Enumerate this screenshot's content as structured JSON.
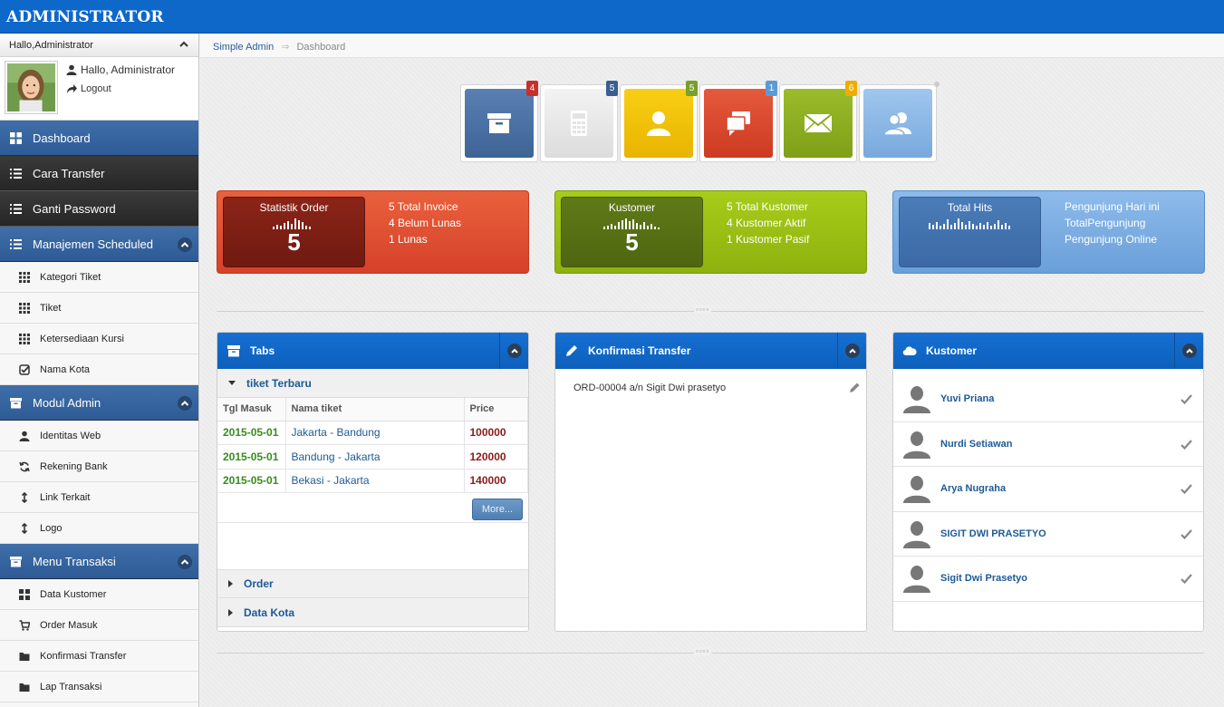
{
  "header": {
    "brand": "ADMINISTRATOR"
  },
  "sidebar": {
    "greeting_header": "Hallo,Administrator",
    "user_name": "Hallo, Administrator",
    "logout_label": "Logout",
    "items": {
      "dashboard": "Dashboard",
      "cara_transfer": "Cara Transfer",
      "ganti_password": "Ganti Password",
      "manajemen_scheduled": "Manajemen Scheduled",
      "kategori_tiket": "Kategori Tiket",
      "tiket": "Tiket",
      "ketersediaan_kursi": "Ketersediaan Kursi",
      "nama_kota": "Nama Kota",
      "modul_admin": "Modul Admin",
      "identitas_web": "Identitas Web",
      "rekening_bank": "Rekening Bank",
      "link_terkait": "Link Terkait",
      "logo": "Logo",
      "menu_transaksi": "Menu Transaksi",
      "data_kustomer": "Data Kustomer",
      "order_masuk": "Order Masuk",
      "konfirmasi_transfer": "Konfirmasi Transfer",
      "lap_transaksi": "Lap Transaksi"
    }
  },
  "breadcrumb": {
    "root": "Simple Admin",
    "sep": "⇒",
    "current": "Dashboard"
  },
  "shortcuts": [
    {
      "icon": "archive-icon",
      "badge": "4",
      "color": "#4a6fa0",
      "badge_color": "#c9302c"
    },
    {
      "icon": "calculator-icon",
      "badge": "5",
      "color": "#e9e9e9",
      "badge_color": "#3a5f8f"
    },
    {
      "icon": "user-icon",
      "badge": "5",
      "color": "#f2c200",
      "badge_color": "#7aa02a"
    },
    {
      "icon": "chat-icon",
      "badge": "1",
      "color": "#d9462c",
      "badge_color": "#5b9bd5"
    },
    {
      "icon": "mail-icon",
      "badge": "6",
      "color": "#8fb022",
      "badge_color": "#f0ad00"
    },
    {
      "icon": "users-icon",
      "badge": "",
      "color": "#8ab8e6",
      "badge_color": "#cccccc"
    }
  ],
  "stats": {
    "order": {
      "title": "Statistik Order",
      "value": "5",
      "lines": [
        "5 Total Invoice",
        "4 Belum Lunas",
        "1 Lunas"
      ]
    },
    "kustomer": {
      "title": "Kustomer",
      "value": "5",
      "lines": [
        "5 Total Kustomer",
        "4 Kustomer Aktif",
        "1 Kustomer Pasif"
      ]
    },
    "hits": {
      "title": "Total Hits",
      "lines": [
        "Pengunjung Hari ini",
        "TotalPengunjung",
        "Pengunjung Online"
      ]
    }
  },
  "tabs_panel": {
    "title": "Tabs",
    "section_title": "tiket Terbaru",
    "columns": [
      "Tgl Masuk",
      "Nama tiket",
      "Price"
    ],
    "rows": [
      [
        "2015-05-01",
        "Jakarta - Bandung",
        "100000"
      ],
      [
        "2015-05-01",
        "Bandung - Jakarta",
        "120000"
      ],
      [
        "2015-05-01",
        "Bekasi - Jakarta",
        "140000"
      ]
    ],
    "more_label": "More...",
    "collapsed": [
      "Order",
      "Data Kota"
    ]
  },
  "konfirmasi_panel": {
    "title": "Konfirmasi Transfer",
    "item": "ORD-00004 a/n Sigit Dwi prasetyo"
  },
  "kustomer_panel": {
    "title": "Kustomer",
    "names": [
      "Yuvi Priana",
      "Nurdi Setiawan",
      "Arya Nugraha",
      "SIGIT DWI PRASETYO",
      "Sigit Dwi Prasetyo"
    ]
  }
}
